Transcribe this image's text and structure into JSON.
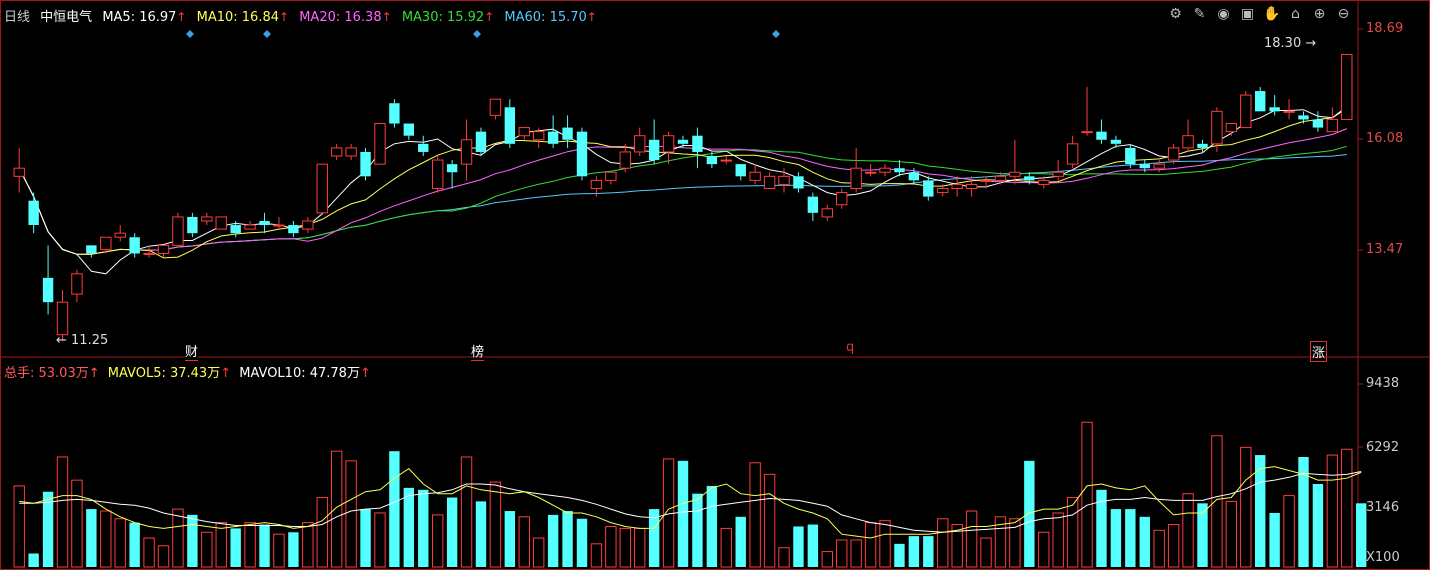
{
  "header": {
    "period": "日线",
    "stock_name": "中恒电气",
    "ma5": "MA5: 16.97",
    "ma10": "MA10: 16.84",
    "ma20": "MA20: 16.38",
    "ma30": "MA30: 15.92",
    "ma60": "MA60: 15.70",
    "arrow": "↑"
  },
  "volume_header": {
    "total": "总手: 53.03万",
    "mavol5": "MAVOL5: 37.43万",
    "mavol10": "MAVOL10: 47.78万",
    "arrow": "↑"
  },
  "toolbar": {
    "icons": [
      "settings-icon",
      "draw-icon",
      "eye-icon",
      "box-icon",
      "hand-icon",
      "lock-icon",
      "zoom-in-icon",
      "zoom-out-icon"
    ]
  },
  "chart_data": [
    {
      "type": "candlestick",
      "title": "",
      "y_axis_ticks": [
        "18.69",
        "16.08",
        "13.47"
      ],
      "ylim": [
        10.9,
        19.1
      ],
      "annotations": {
        "high_label": "18.30",
        "low_label": "11.25",
        "markers": [
          "财",
          "榜",
          "q",
          "涨"
        ]
      },
      "colors": {
        "up": "#ff3b3b",
        "down": "#54ffff",
        "ma5": "#ffffff",
        "ma10": "#ffff55",
        "ma20": "#ff66ff",
        "ma30": "#33dd33",
        "ma60": "#55c8ff"
      },
      "candles": [
        [
          15.3,
          15.5,
          14.9,
          16.0
        ],
        [
          14.7,
          14.1,
          13.9,
          14.9
        ],
        [
          12.8,
          12.2,
          11.9,
          13.6
        ],
        [
          11.4,
          12.2,
          11.25,
          12.5
        ],
        [
          12.4,
          12.9,
          12.2,
          13.0
        ],
        [
          13.6,
          13.4,
          13.3,
          13.6
        ],
        [
          13.5,
          13.8,
          13.4,
          13.8
        ],
        [
          13.8,
          13.9,
          13.7,
          14.1
        ],
        [
          13.8,
          13.4,
          13.3,
          13.9
        ],
        [
          13.4,
          13.4,
          13.3,
          13.6
        ],
        [
          13.4,
          13.6,
          13.3,
          13.6
        ],
        [
          13.6,
          14.3,
          13.6,
          14.4
        ],
        [
          14.3,
          13.9,
          13.8,
          14.4
        ],
        [
          14.2,
          14.3,
          14.1,
          14.4
        ],
        [
          14.0,
          14.3,
          14.0,
          14.3
        ],
        [
          14.1,
          13.9,
          13.8,
          14.2
        ],
        [
          14.0,
          14.1,
          14.0,
          14.2
        ],
        [
          14.2,
          14.1,
          13.9,
          14.4
        ],
        [
          14.1,
          14.1,
          14.0,
          14.3
        ],
        [
          14.1,
          13.9,
          13.8,
          14.2
        ],
        [
          14.0,
          14.2,
          13.9,
          14.3
        ],
        [
          14.4,
          15.6,
          14.4,
          15.6
        ],
        [
          15.8,
          16.0,
          15.7,
          16.1
        ],
        [
          15.8,
          16.0,
          15.7,
          16.1
        ],
        [
          15.9,
          15.3,
          15.2,
          16.0
        ],
        [
          15.6,
          16.6,
          15.6,
          16.6
        ],
        [
          17.1,
          16.6,
          16.5,
          17.2
        ],
        [
          16.6,
          16.3,
          16.2,
          16.6
        ],
        [
          16.1,
          15.9,
          15.8,
          16.3
        ],
        [
          15.0,
          15.7,
          14.9,
          15.8
        ],
        [
          15.6,
          15.4,
          15.0,
          15.7
        ],
        [
          15.6,
          16.2,
          15.2,
          16.7
        ],
        [
          16.4,
          15.9,
          15.8,
          16.5
        ],
        [
          16.8,
          17.2,
          16.7,
          17.2
        ],
        [
          17.0,
          16.1,
          16.0,
          17.2
        ],
        [
          16.3,
          16.5,
          16.2,
          16.5
        ],
        [
          16.2,
          16.4,
          16.0,
          16.5
        ],
        [
          16.4,
          16.1,
          16.0,
          16.8
        ],
        [
          16.5,
          16.2,
          16.0,
          16.8
        ],
        [
          16.4,
          15.3,
          15.2,
          16.5
        ],
        [
          15.0,
          15.2,
          14.8,
          15.3
        ],
        [
          15.2,
          15.4,
          15.1,
          15.4
        ],
        [
          15.5,
          15.9,
          15.4,
          16.1
        ],
        [
          15.9,
          16.3,
          15.8,
          16.5
        ],
        [
          16.2,
          15.7,
          15.6,
          16.7
        ],
        [
          15.9,
          16.3,
          15.6,
          16.4
        ],
        [
          16.2,
          16.1,
          16.0,
          16.3
        ],
        [
          16.3,
          15.9,
          15.5,
          16.5
        ],
        [
          15.8,
          15.6,
          15.5,
          15.9
        ],
        [
          15.7,
          15.7,
          15.6,
          15.8
        ],
        [
          15.6,
          15.3,
          15.2,
          15.6
        ],
        [
          15.2,
          15.4,
          15.1,
          15.6
        ],
        [
          15.0,
          15.3,
          15.0,
          15.4
        ],
        [
          15.1,
          15.3,
          14.9,
          15.5
        ],
        [
          15.3,
          15.0,
          14.9,
          15.4
        ],
        [
          14.8,
          14.4,
          14.2,
          14.9
        ],
        [
          14.3,
          14.5,
          14.2,
          14.6
        ],
        [
          14.6,
          14.9,
          14.5,
          15.0
        ],
        [
          15.0,
          15.5,
          14.9,
          16.0
        ],
        [
          15.4,
          15.4,
          15.3,
          15.6
        ],
        [
          15.4,
          15.5,
          15.3,
          15.6
        ],
        [
          15.5,
          15.4,
          15.3,
          15.7
        ],
        [
          15.4,
          15.2,
          15.1,
          15.5
        ],
        [
          15.2,
          14.8,
          14.7,
          15.3
        ],
        [
          14.9,
          15.0,
          14.8,
          15.1
        ],
        [
          15.0,
          15.1,
          14.8,
          15.3
        ],
        [
          15.0,
          15.1,
          14.8,
          15.3
        ],
        [
          15.2,
          15.2,
          15.0,
          15.3
        ],
        [
          15.2,
          15.3,
          15.1,
          15.4
        ],
        [
          15.3,
          15.4,
          15.1,
          16.2
        ],
        [
          15.3,
          15.2,
          15.1,
          15.4
        ],
        [
          15.1,
          15.2,
          15.0,
          15.3
        ],
        [
          15.3,
          15.4,
          15.2,
          15.7
        ],
        [
          15.6,
          16.1,
          15.5,
          16.3
        ],
        [
          16.4,
          16.4,
          16.3,
          17.5
        ],
        [
          16.4,
          16.2,
          16.1,
          16.7
        ],
        [
          16.2,
          16.1,
          16.0,
          16.3
        ],
        [
          16.0,
          15.6,
          15.5,
          16.1
        ],
        [
          15.6,
          15.5,
          15.4,
          15.7
        ],
        [
          15.5,
          15.6,
          15.4,
          15.7
        ],
        [
          15.7,
          16.0,
          15.6,
          16.1
        ],
        [
          16.0,
          16.3,
          15.9,
          16.7
        ],
        [
          16.1,
          16.0,
          15.9,
          16.2
        ],
        [
          16.1,
          16.9,
          15.9,
          17.0
        ],
        [
          16.4,
          16.6,
          16.3,
          16.6
        ],
        [
          16.5,
          17.3,
          16.5,
          17.4
        ],
        [
          17.4,
          16.9,
          16.9,
          17.5
        ],
        [
          17.0,
          16.9,
          16.8,
          17.3
        ],
        [
          16.9,
          16.9,
          16.7,
          17.2
        ],
        [
          16.8,
          16.7,
          16.6,
          16.9
        ],
        [
          16.7,
          16.5,
          16.4,
          16.9
        ],
        [
          16.4,
          16.7,
          16.4,
          17.0
        ],
        [
          16.7,
          18.3,
          16.7,
          18.3
        ]
      ]
    },
    {
      "type": "bar",
      "title": "",
      "unit": "X100",
      "y_axis_ticks": [
        "9438",
        "6292",
        "3146"
      ],
      "ylim": [
        0,
        10000
      ],
      "volumes": [
        4200,
        700,
        3900,
        5700,
        4500,
        3000,
        2900,
        2500,
        2300,
        1500,
        1100,
        3000,
        2700,
        1800,
        2300,
        2000,
        2300,
        2200,
        1700,
        1800,
        2300,
        3600,
        6000,
        5500,
        3000,
        2800,
        6000,
        4100,
        4000,
        2700,
        3600,
        5700,
        3400,
        4400,
        2900,
        2600,
        1500,
        2700,
        2900,
        2500,
        1200,
        2100,
        2000,
        2000,
        3000,
        5600,
        5500,
        3800,
        4200,
        2000,
        2600,
        5400,
        4800,
        1000,
        2100,
        2200,
        800,
        1400,
        1400,
        2300,
        2400,
        1200,
        1600,
        1600,
        2500,
        2200,
        2900,
        1500,
        2600,
        2500,
        5500,
        1800,
        2800,
        3600,
        7500,
        4000,
        3000,
        3000,
        2600,
        1900,
        2200,
        3800,
        3300,
        6800,
        3400,
        6200,
        5800,
        2800,
        3700,
        5700,
        4300,
        5800,
        6100,
        3300
      ],
      "mavol5": [
        3400,
        3300,
        3500,
        3700,
        3700,
        3500,
        3000,
        2600,
        2300,
        2100,
        2000,
        2100,
        2200,
        2100,
        2000,
        2100,
        2200,
        2300,
        2200,
        2000,
        2100,
        2400,
        3100,
        3500,
        3900,
        4000,
        4600,
        5100,
        4300,
        3800,
        3800,
        4200,
        4000,
        3900,
        3800,
        3900,
        3600,
        3200,
        2800,
        2800,
        2600,
        2300,
        2100,
        2000,
        2000,
        3000,
        3300,
        3500,
        4100,
        4300,
        3800,
        3700,
        3800,
        3300,
        3000,
        2800,
        2500,
        1700,
        1600,
        1500,
        1700,
        1700,
        1700,
        1700,
        1800,
        1900,
        2100,
        2100,
        2200,
        2300,
        2800,
        3000,
        3000,
        3200,
        4200,
        4300,
        4100,
        4000,
        4200,
        3400,
        2700,
        2800,
        2800,
        3500,
        3600,
        4500,
        5100,
        5200,
        5000,
        4800,
        4500,
        4500,
        4600,
        4900
      ],
      "mavol10": [
        3300,
        3300,
        3350,
        3450,
        3500,
        3450,
        3350,
        3250,
        3200,
        3050,
        2800,
        2650,
        2500,
        2350,
        2250,
        2150,
        2150,
        2150,
        2150,
        2100,
        2100,
        2200,
        2600,
        2900,
        3000,
        3050,
        3350,
        3700,
        3800,
        3850,
        4000,
        4300,
        4300,
        4250,
        4050,
        3900,
        3800,
        3700,
        3600,
        3450,
        3250,
        3000,
        2750,
        2600,
        2550,
        2750,
        2850,
        2900,
        3150,
        3250,
        3350,
        3450,
        3550,
        3500,
        3450,
        3300,
        3150,
        2700,
        2500,
        2300,
        2200,
        2050,
        1900,
        1850,
        1800,
        1850,
        1900,
        1950,
        2000,
        2050,
        2350,
        2500,
        2550,
        2700,
        3200,
        3400,
        3500,
        3500,
        3600,
        3500,
        3450,
        3450,
        3450,
        3650,
        3800,
        4050,
        4400,
        4500,
        4650,
        4850,
        4800,
        4750,
        4800,
        4950
      ]
    }
  ]
}
